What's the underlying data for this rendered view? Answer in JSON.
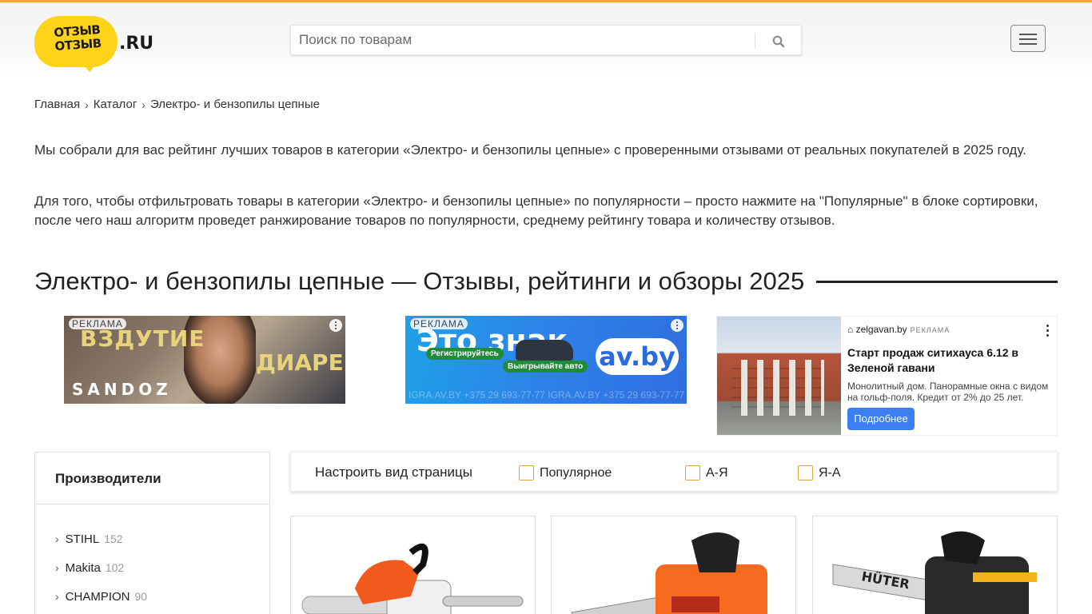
{
  "site": {
    "logo_line1": "ОТЗЫВ",
    "logo_line2": "ОТЗЫВ",
    "logo_tld": ".RU"
  },
  "search": {
    "placeholder": "Поиск по товарам",
    "icon": "search-icon"
  },
  "menu": {
    "icon": "hamburger-icon"
  },
  "breadcrumb": [
    "Главная",
    "Каталог",
    "Электро- и бензопилы цепные"
  ],
  "intro": {
    "p1": "Мы собрали для вас рейтинг лучших товаров в категории «Электро- и бензопилы цепные» с проверенными отзывами от реальных покупателей в 2025 году.",
    "p2": "Для того, чтобы отфильтровать товары в категории «Электро- и бензопилы цепные» по популярности – просто нажмите на \"Популярные\" в блоке сортировки, после чего наш алгоритм проведет ранжирование товаров по популярности, среднему рейтингу товара и количеству отзывов."
  },
  "page_title": "Электро- и бензопилы цепные — Отзывы, рейтинги и обзоры 2025",
  "ads": {
    "ad1": {
      "tag": "РЕКЛАМА",
      "text1": "ВЗДУТИЕ",
      "text2": "ДИАРЕЯ",
      "brand": "SANDOZ"
    },
    "ad2": {
      "tag": "РЕКЛАМА",
      "big": "Это знак",
      "pill1": "Регистрируйтесь",
      "pill2": "Выигрывайте авто",
      "brand": "av.by",
      "footer": "IGRA.AV.BY +375 29 693-77-77 IGRA.AV.BY +375 29 693-77-77"
    },
    "ad3": {
      "site": "zelgavan.by",
      "tag": "РЕКЛАМА",
      "title": "Старт продаж ситихауса 6.12 в Зеленой гавани",
      "desc": "Монолитный дом. Панорамные окна с видом на гольф-поля. Кредит от 2% до 25 лет.",
      "cta": "Подробнее"
    }
  },
  "sidebar": {
    "title": "Производители",
    "items": [
      {
        "name": "STIHL",
        "count": "152"
      },
      {
        "name": "Makita",
        "count": "102"
      },
      {
        "name": "CHAMPION",
        "count": "90"
      }
    ]
  },
  "sort": {
    "label": "Настроить вид страницы",
    "options": [
      "Популярное",
      "А-Я",
      "Я-А"
    ]
  },
  "colors": {
    "accent": "#f5a623",
    "logo_yellow": "#ffd31a",
    "checkbox_border": "#e3a23a"
  }
}
